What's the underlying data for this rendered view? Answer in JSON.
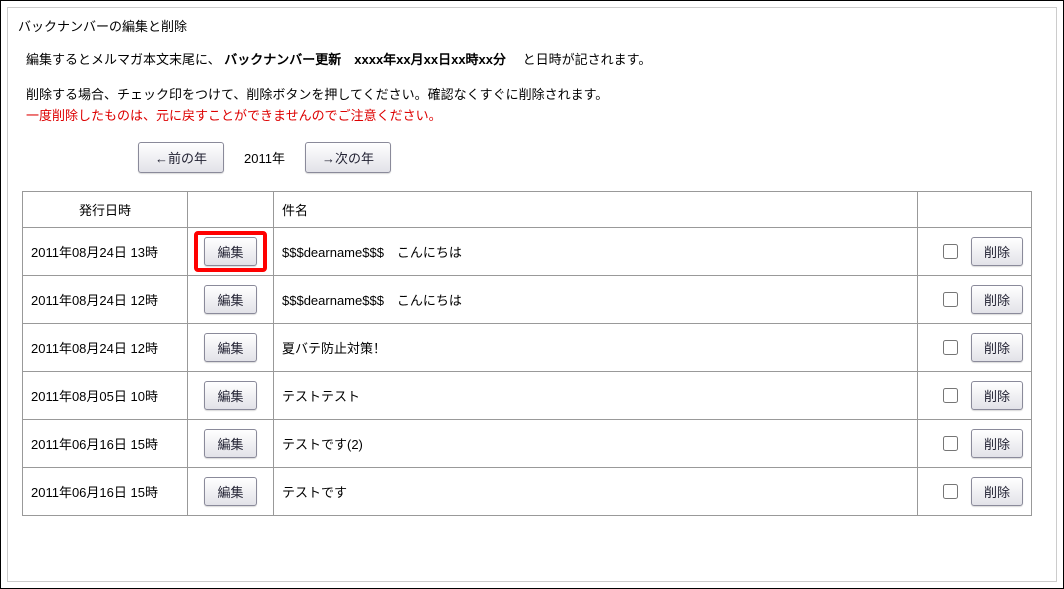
{
  "fieldset_title": "バックナンバーの編集と削除",
  "intro": {
    "line1_pre": "編集するとメルマガ本文末尾に、",
    "line1_bold": "バックナンバー更新　xxxx年xx月xx日xx時xx分",
    "line1_post": "　と日時が記されます。",
    "line2": "削除する場合、チェック印をつけて、削除ボタンを押してください。確認なくすぐに削除されます。",
    "line3": "一度削除したものは、元に戻すことができませんのでご注意ください。"
  },
  "year_nav": {
    "prev_label": "←前の年",
    "year_label": "2011年",
    "next_label": "→次の年"
  },
  "table": {
    "headers": {
      "date": "発行日時",
      "edit": " ",
      "subject": "件名",
      "delete": " "
    },
    "edit_button_label": "編集",
    "delete_button_label": "削除",
    "rows": [
      {
        "date": "2011年08月24日 13時",
        "subject": "$$$dearname$$$　こんにちは",
        "highlight": true
      },
      {
        "date": "2011年08月24日 12時",
        "subject": "$$$dearname$$$　こんにちは",
        "highlight": false
      },
      {
        "date": "2011年08月24日 12時",
        "subject": "夏バテ防止対策！",
        "highlight": false
      },
      {
        "date": "2011年08月05日 10時",
        "subject": "テストテスト",
        "highlight": false
      },
      {
        "date": "2011年06月16日 15時",
        "subject": "テストです(2)",
        "highlight": false
      },
      {
        "date": "2011年06月16日 15時",
        "subject": "テストです",
        "highlight": false
      }
    ]
  }
}
